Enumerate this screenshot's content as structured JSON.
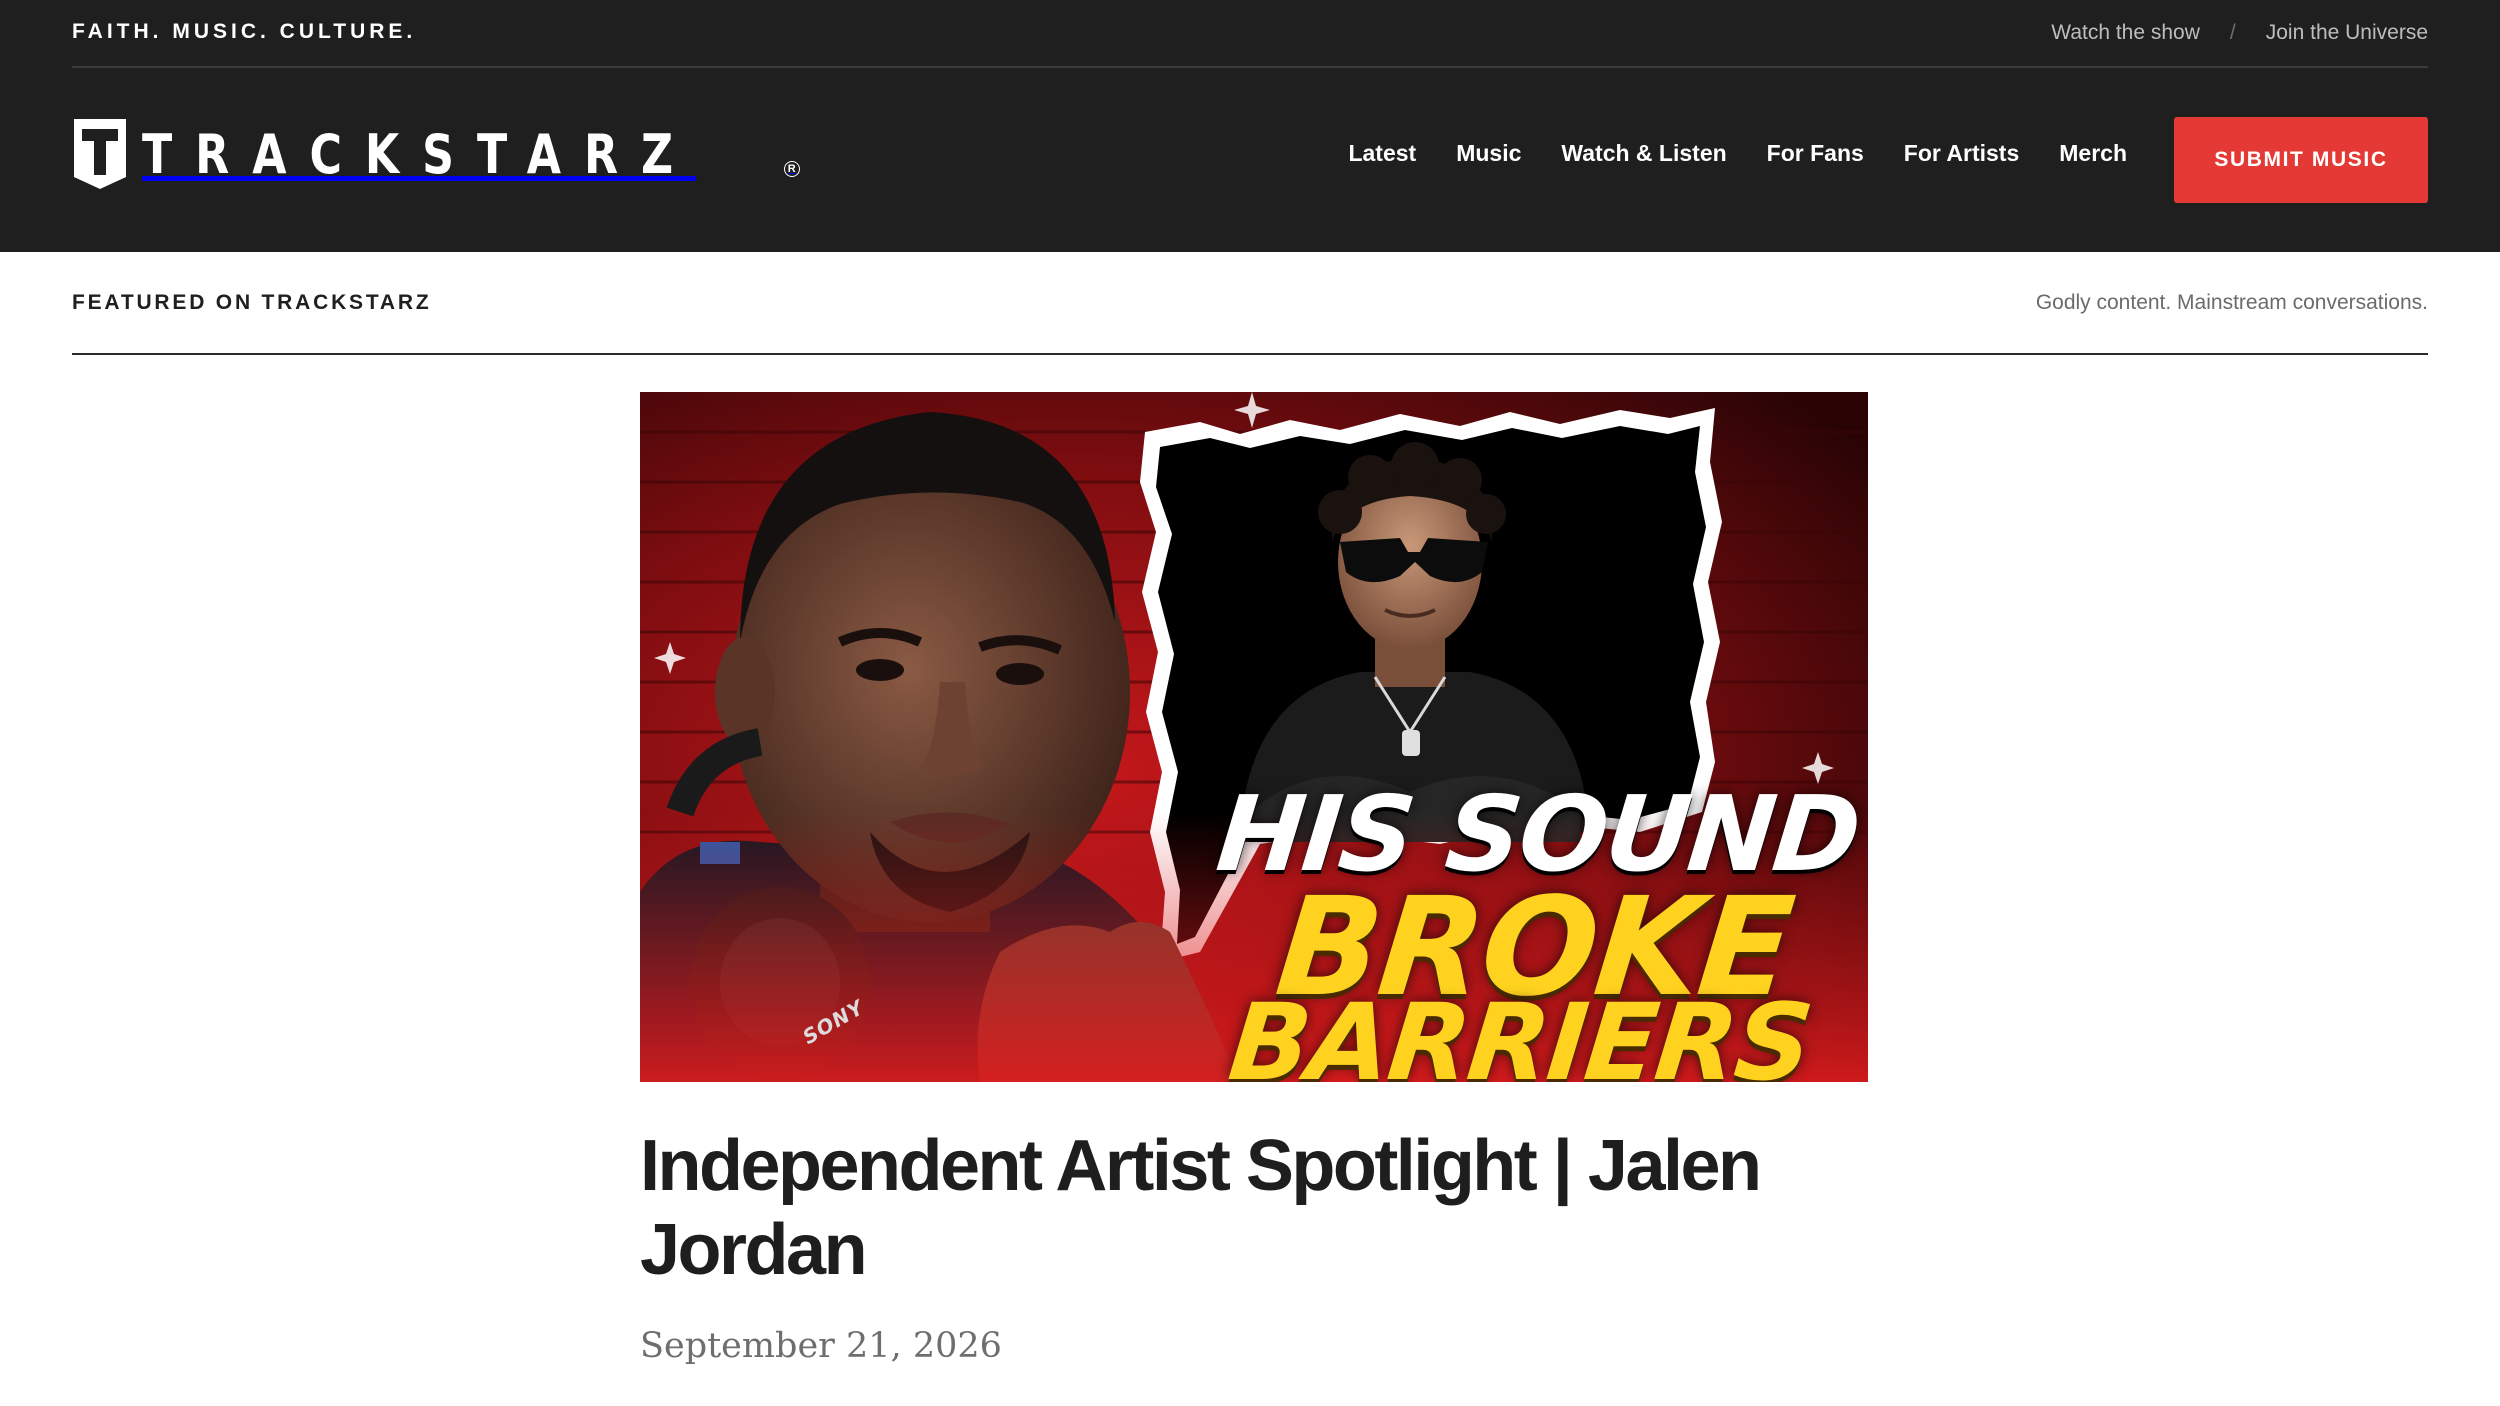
{
  "topbar": {
    "tagline": "FAITH. MUSIC. CULTURE.",
    "links": [
      "Watch the show",
      "Join the Universe"
    ],
    "separator": "/"
  },
  "logo": {
    "mark_letter": "T",
    "wordmark": "TRACKSTARZ",
    "registered": "R"
  },
  "nav": {
    "items": [
      "Latest",
      "Music",
      "Watch & Listen",
      "For Fans",
      "For Artists",
      "Merch"
    ],
    "cta_label": "SUBMIT MUSIC"
  },
  "featured": {
    "label": "FEATURED ON TRACKSTARZ",
    "tagline": "Godly content. Mainstream conversations."
  },
  "hero": {
    "line1": "HIS SOUND",
    "line2": "BROKE",
    "line3": "BARRIERS",
    "headphone_brand": "SONY"
  },
  "article": {
    "title": "Independent Artist Spotlight | Jalen Jordan",
    "date": "September 21, 2026"
  },
  "colors": {
    "header_bg": "#1f1f1f",
    "accent_red": "#e53935",
    "hero_yellow": "#ffd21f"
  }
}
